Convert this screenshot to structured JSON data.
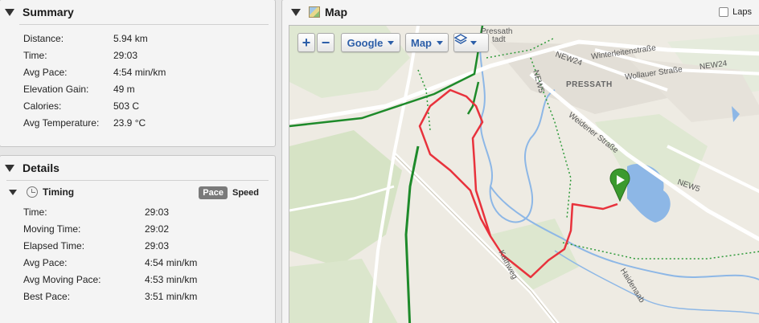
{
  "summary": {
    "title": "Summary",
    "rows": [
      {
        "label": "Distance:",
        "value": "5.94 km"
      },
      {
        "label": "Time:",
        "value": "29:03"
      },
      {
        "label": "Avg Pace:",
        "value": "4:54 min/km"
      },
      {
        "label": "Elevation Gain:",
        "value": "49 m"
      },
      {
        "label": "Calories:",
        "value": "503 C"
      },
      {
        "label": "Avg Temperature:",
        "value": "23.9 °C"
      }
    ]
  },
  "details": {
    "title": "Details",
    "timing": {
      "label": "Timing",
      "toggle_pace": "Pace",
      "toggle_speed": "Speed",
      "selected": "Pace",
      "rows": [
        {
          "label": "Time:",
          "value": "29:03"
        },
        {
          "label": "Moving Time:",
          "value": "29:02"
        },
        {
          "label": "Elapsed Time:",
          "value": "29:03"
        },
        {
          "label": "Avg Pace:",
          "value": "4:54 min/km"
        },
        {
          "label": "Avg Moving Pace:",
          "value": "4:53 min/km"
        },
        {
          "label": "Best Pace:",
          "value": "3:51 min/km"
        }
      ]
    }
  },
  "map": {
    "title": "Map",
    "laps_label": "Laps",
    "laps_checked": false,
    "zoom_in": "+",
    "zoom_out": "−",
    "provider": "Google",
    "view_type": "Map",
    "labels": {
      "town": "PRESSATH",
      "town_top": "Pressath",
      "stadt": "tadt",
      "winterleiten": "Winterleitenstraße",
      "wollauer": "Wollauer Straße",
      "new24_a": "NEW24",
      "new24_b": "NEW24",
      "new5_a": "NEW5",
      "new5_b": "NEW5",
      "weidener": "Weidener Straße",
      "kirchweg": "Kathweg",
      "haidenaab": "Haidenaab"
    },
    "colors": {
      "route": "#e8323c",
      "rail": "#1e8a2a",
      "water": "#8db7e6",
      "path": "#2f9a3a"
    },
    "icons": {
      "start_marker": "play-pin-icon"
    }
  }
}
